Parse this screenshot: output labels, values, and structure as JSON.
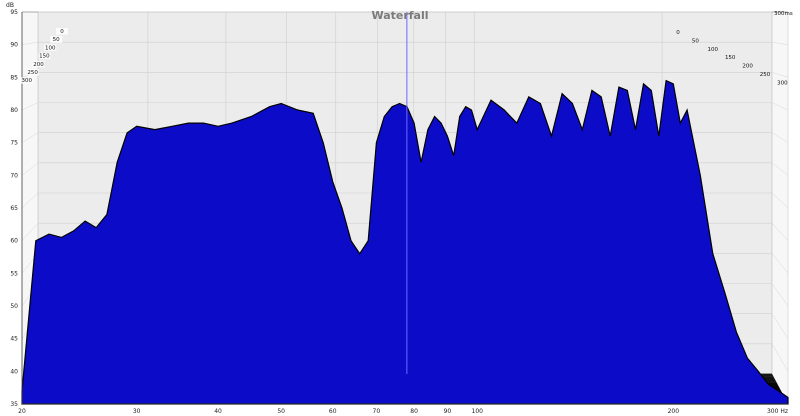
{
  "chart_data": {
    "type": "area",
    "title": "Waterfall",
    "ylabel": "dB",
    "xlabel": "",
    "x_scale": "log",
    "xlim": [
      20,
      300
    ],
    "ylim": [
      35,
      95
    ],
    "x_ticks": [
      "20",
      "30",
      "40",
      "50",
      "60",
      "70",
      "80",
      "90",
      "100",
      "200",
      "300 Hz"
    ],
    "x_tick_values": [
      20,
      30,
      40,
      50,
      60,
      70,
      80,
      90,
      100,
      200,
      300
    ],
    "y_ticks": [
      "95",
      "90",
      "85",
      "80",
      "75",
      "70",
      "65",
      "60",
      "55",
      "50",
      "45",
      "40",
      "35"
    ],
    "y_tick_values": [
      95,
      90,
      85,
      80,
      75,
      70,
      65,
      60,
      55,
      50,
      45,
      40,
      35
    ],
    "depth_ticks_left": [
      "0",
      "50",
      "100",
      "150",
      "200",
      "250",
      "300"
    ],
    "depth_ticks_right": [
      "0",
      "50",
      "100",
      "150",
      "200",
      "250",
      "300"
    ],
    "depth_end_label": "300ms",
    "cursor_x": 78,
    "fill_color": "#0c0cc8",
    "edge_color": "#000000",
    "grid": true,
    "series": [
      {
        "time_ms": 0,
        "x": [
          20,
          21,
          22,
          23,
          24,
          25,
          26,
          27,
          28,
          29,
          30,
          32,
          34,
          36,
          38,
          40,
          42,
          45,
          48,
          50,
          53,
          56,
          58,
          60,
          62,
          64,
          66,
          68,
          70,
          72,
          74,
          76,
          78,
          80,
          82,
          84,
          86,
          88,
          90,
          92,
          94,
          96,
          98,
          100,
          105,
          110,
          115,
          120,
          125,
          130,
          135,
          140,
          145,
          150,
          155,
          160,
          165,
          170,
          175,
          180,
          185,
          190,
          195,
          200,
          205,
          210,
          220,
          230,
          240,
          250,
          260,
          270,
          280,
          290,
          300
        ],
        "y": [
          37,
          60,
          61,
          60.5,
          61.5,
          63,
          62,
          64,
          72,
          76.5,
          77.5,
          77,
          77.5,
          78,
          78,
          77.5,
          78,
          79,
          80.5,
          81,
          80,
          79.5,
          75,
          69,
          65,
          60,
          58,
          60,
          75,
          79,
          80.5,
          81,
          80.5,
          78,
          72,
          77,
          79,
          78,
          76,
          73,
          79,
          80.5,
          80,
          77,
          81.5,
          80,
          78,
          82,
          81,
          76,
          82.5,
          81,
          77,
          83,
          82,
          76,
          83.5,
          83,
          77,
          84,
          83,
          76,
          84.5,
          84,
          78,
          80,
          70,
          58,
          52,
          46,
          42,
          40,
          38,
          37,
          36
        ]
      }
    ]
  }
}
